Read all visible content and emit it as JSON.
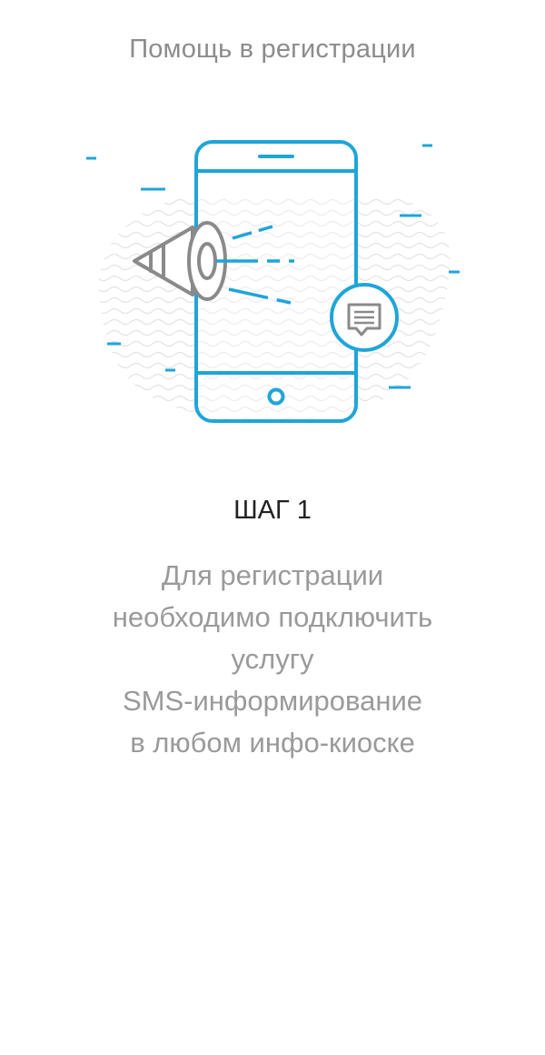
{
  "header": {
    "title": "Помощь в регистрации"
  },
  "illustration": {
    "icons": [
      "phone-icon",
      "megaphone-icon",
      "sms-message-icon"
    ],
    "accent_color": "#1fa5d8",
    "stroke_color": "#8a8a8a"
  },
  "step": {
    "title": "ШАГ 1",
    "description_lines": [
      "Для регистрации",
      "необходимо подключить",
      "услугу",
      "SMS-информирование",
      "в любом инфо-киоске"
    ]
  }
}
